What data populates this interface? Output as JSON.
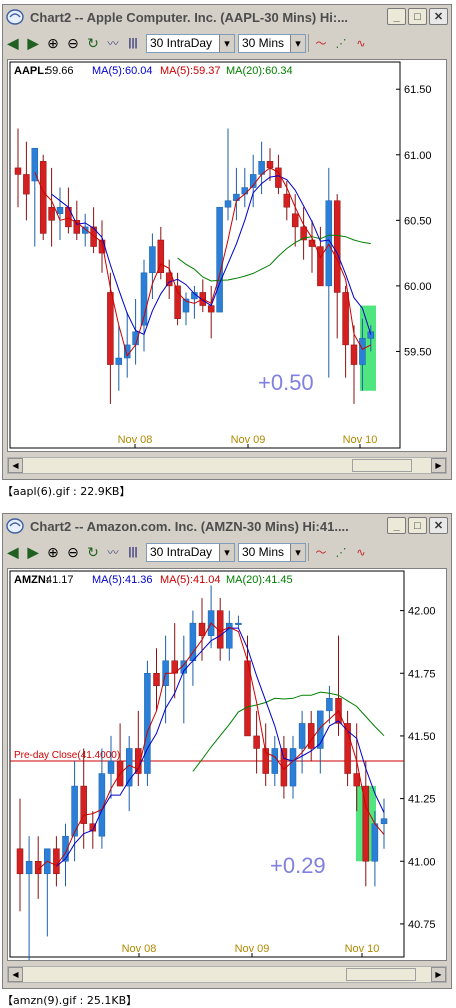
{
  "windows": [
    {
      "title": "Chart2 -- Apple Computer. Inc. (AAPL-30 Mins)   Hi:...",
      "interval_select": "30 IntraDay",
      "period_select": "30 Mins",
      "symbol_label": "AAPL:",
      "symbol_value": "59.66",
      "ma5_blue": "MA(5):60.04",
      "ma5_red": "MA(5):59.37",
      "ma20": "MA(20):60.34",
      "price_ticks": [
        "61.50",
        "61.00",
        "60.50",
        "60.00",
        "59.50"
      ],
      "date_ticks": [
        "Nov 08",
        "Nov 09",
        "Nov 10"
      ],
      "annotation": "+0.50",
      "caption": "【aapl(6).gif : 22.9KB】"
    },
    {
      "title": "Chart2 -- Amazon.com. Inc. (AMZN-30 Mins)   Hi:41....",
      "interval_select": "30 IntraDay",
      "period_select": "30 Mins",
      "symbol_label": "AMZN:",
      "symbol_value": "41.17",
      "ma5_blue": "MA(5):41.36",
      "ma5_red": "MA(5):41.04",
      "ma20": "MA(20):41.45",
      "reference_line": "Pre-day Close(41.4000)",
      "price_ticks": [
        "42.00",
        "41.75",
        "41.50",
        "41.25",
        "41.00",
        "40.75"
      ],
      "date_ticks": [
        "Nov 08",
        "Nov 09",
        "Nov 10"
      ],
      "annotation": "+0.29",
      "caption": "【amzn(9).gif : 25.1KB】"
    }
  ],
  "colors": {
    "up_candle": "#2b7fd6",
    "down_candle": "#d42020",
    "ma_blue": "#0000cc",
    "ma_red": "#cc0000",
    "ma_green": "#008000",
    "annotation": "#8080e0",
    "highlight": "#33e06a",
    "date_label": "#b08a00"
  },
  "chart_data": [
    {
      "type": "candlestick",
      "symbol": "AAPL",
      "ylim": [
        59.0,
        61.7
      ],
      "x": [
        "Nov 08",
        "Nov 09",
        "Nov 10"
      ],
      "ohlc_approx": [
        [
          60.9,
          61.2,
          60.6,
          60.85
        ],
        [
          60.85,
          61.1,
          60.5,
          60.7
        ],
        [
          60.8,
          61.05,
          60.3,
          61.05
        ],
        [
          60.95,
          61.0,
          60.35,
          60.4
        ],
        [
          60.6,
          60.9,
          60.3,
          60.5
        ],
        [
          60.55,
          60.75,
          60.35,
          60.6
        ],
        [
          60.6,
          60.75,
          60.4,
          60.45
        ],
        [
          60.5,
          60.65,
          60.35,
          60.4
        ],
        [
          60.4,
          60.55,
          60.3,
          60.45
        ],
        [
          60.45,
          60.6,
          60.25,
          60.3
        ],
        [
          60.35,
          60.5,
          60.1,
          60.25
        ],
        [
          59.95,
          60.1,
          59.1,
          59.4
        ],
        [
          59.4,
          59.7,
          59.2,
          59.45
        ],
        [
          59.45,
          59.8,
          59.3,
          59.55
        ],
        [
          59.55,
          59.9,
          59.4,
          59.65
        ],
        [
          59.7,
          60.2,
          59.5,
          60.1
        ],
        [
          60.1,
          60.4,
          59.9,
          60.3
        ],
        [
          60.35,
          60.45,
          60.05,
          60.1
        ],
        [
          60.1,
          60.2,
          59.9,
          60.0
        ],
        [
          60.0,
          60.1,
          59.7,
          59.75
        ],
        [
          59.8,
          59.95,
          59.7,
          59.9
        ],
        [
          59.9,
          60.0,
          59.75,
          59.95
        ],
        [
          59.95,
          60.05,
          59.8,
          59.85
        ],
        [
          59.85,
          60.0,
          59.6,
          59.8
        ],
        [
          59.8,
          60.3,
          59.8,
          60.6
        ],
        [
          60.6,
          61.2,
          60.5,
          60.65
        ],
        [
          60.65,
          60.9,
          60.5,
          60.7
        ],
        [
          60.7,
          60.9,
          60.6,
          60.75
        ],
        [
          60.75,
          61.0,
          60.6,
          60.85
        ],
        [
          60.85,
          61.1,
          60.7,
          60.95
        ],
        [
          60.95,
          61.05,
          60.8,
          60.9
        ],
        [
          60.9,
          61.0,
          60.7,
          60.75
        ],
        [
          60.7,
          60.8,
          60.5,
          60.6
        ],
        [
          60.55,
          60.7,
          60.3,
          60.45
        ],
        [
          60.45,
          60.6,
          60.2,
          60.35
        ],
        [
          60.35,
          60.5,
          60.1,
          60.3
        ],
        [
          60.3,
          60.45,
          60.05,
          60.0
        ],
        [
          60.0,
          60.9,
          59.3,
          60.65
        ],
        [
          60.65,
          60.7,
          59.6,
          59.95
        ],
        [
          59.95,
          60.0,
          59.3,
          59.55
        ],
        [
          59.55,
          59.7,
          59.1,
          59.4
        ],
        [
          59.4,
          59.75,
          59.2,
          59.6
        ],
        [
          59.6,
          59.7,
          59.5,
          59.65
        ]
      ]
    },
    {
      "type": "candlestick",
      "symbol": "AMZN",
      "ylim": [
        40.65,
        42.15
      ],
      "x": [
        "Nov 08",
        "Nov 09",
        "Nov 10"
      ],
      "reference_line": 41.4
    }
  ]
}
